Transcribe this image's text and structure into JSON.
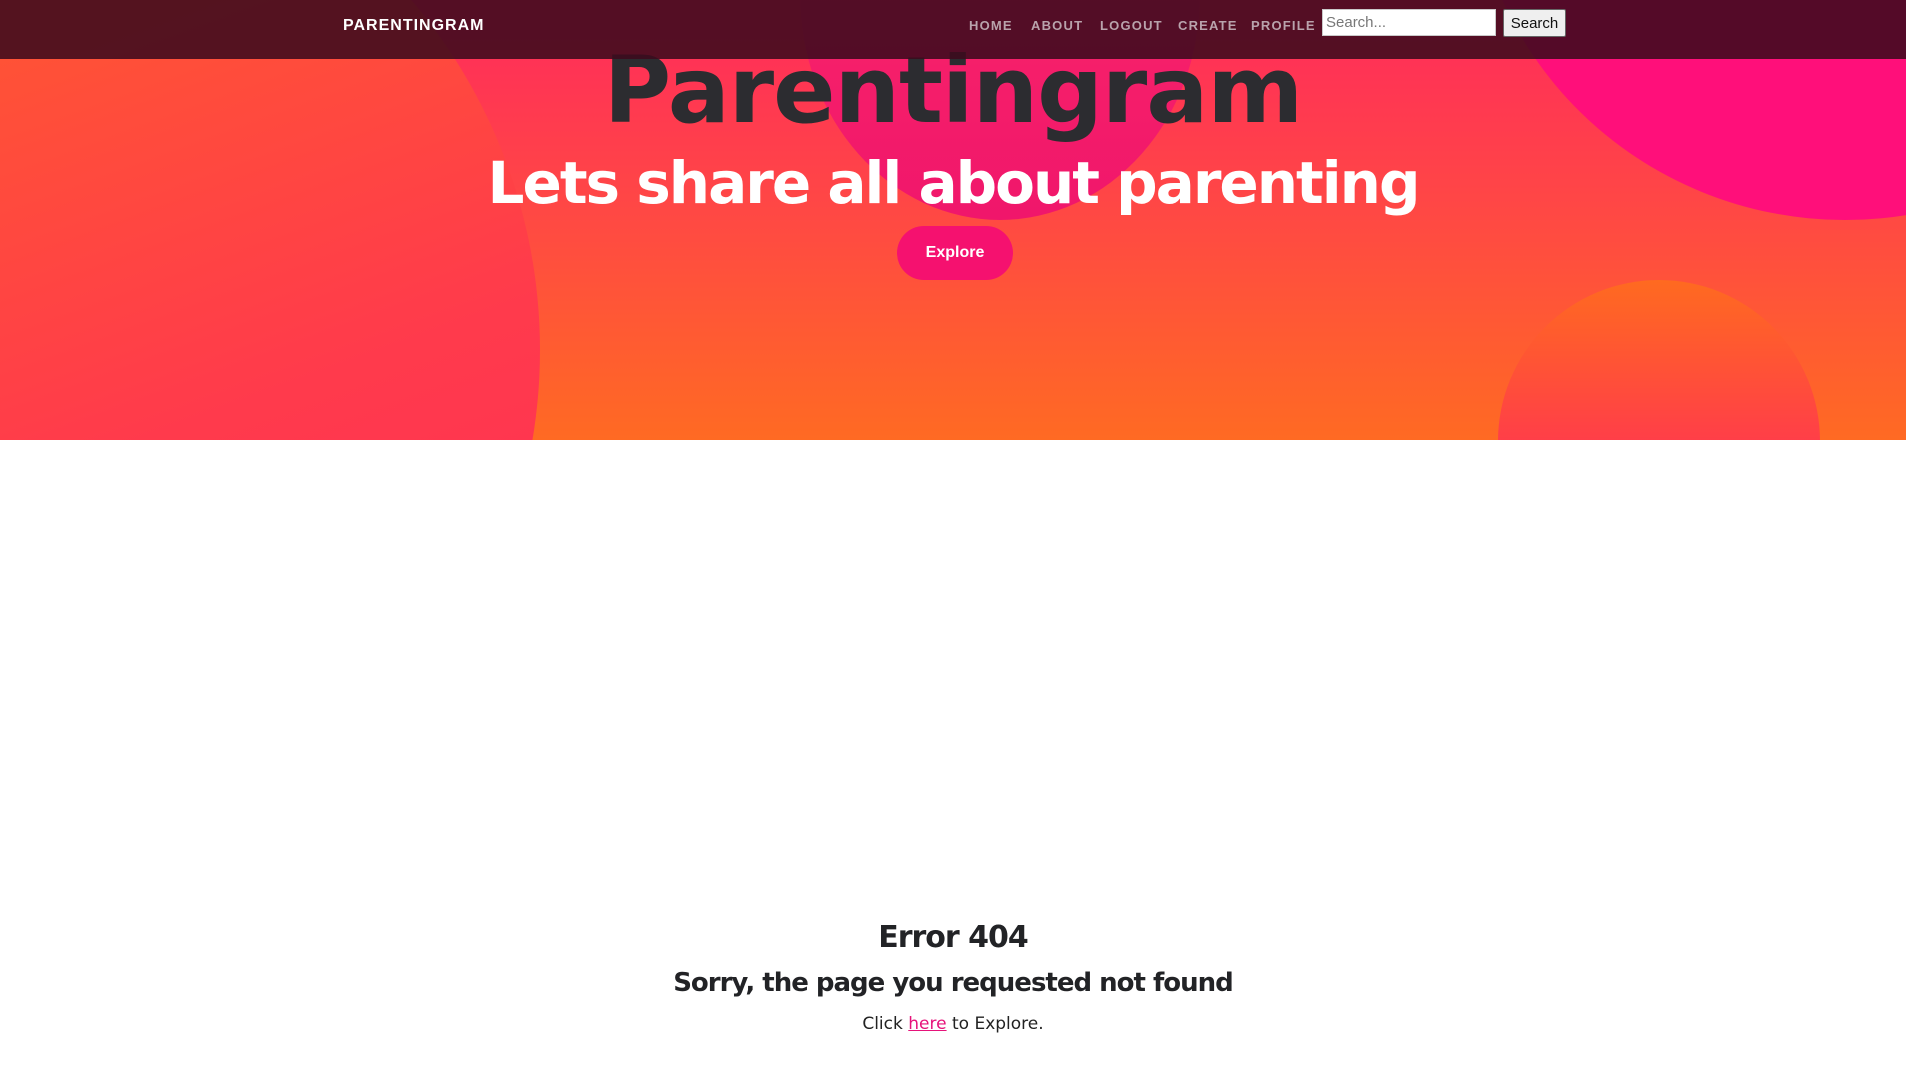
{
  "navbar": {
    "brand": "PARENTINGRAM",
    "links": [
      "HOME",
      "ABOUT",
      "LOGOUT",
      "CREATE",
      "PROFILE"
    ],
    "search": {
      "placeholder": "Search...",
      "value": "",
      "button_label": "Search"
    }
  },
  "hero": {
    "title": "Parentingram",
    "subtitle": "Lets share all about parenting",
    "button_label": "Explore"
  },
  "error": {
    "title": "Error 404",
    "subtitle": "Sorry, the page you requested not found",
    "text_before": "Click ",
    "link_label": "here",
    "text_after": " to Explore."
  },
  "colors": {
    "navbar_bg": "#3c0a1c",
    "hero_gradient_top": "#ff2a5c",
    "hero_gradient_bottom": "#ff6a23",
    "accent": "#f5116f",
    "text_dark": "#2c2c30"
  }
}
